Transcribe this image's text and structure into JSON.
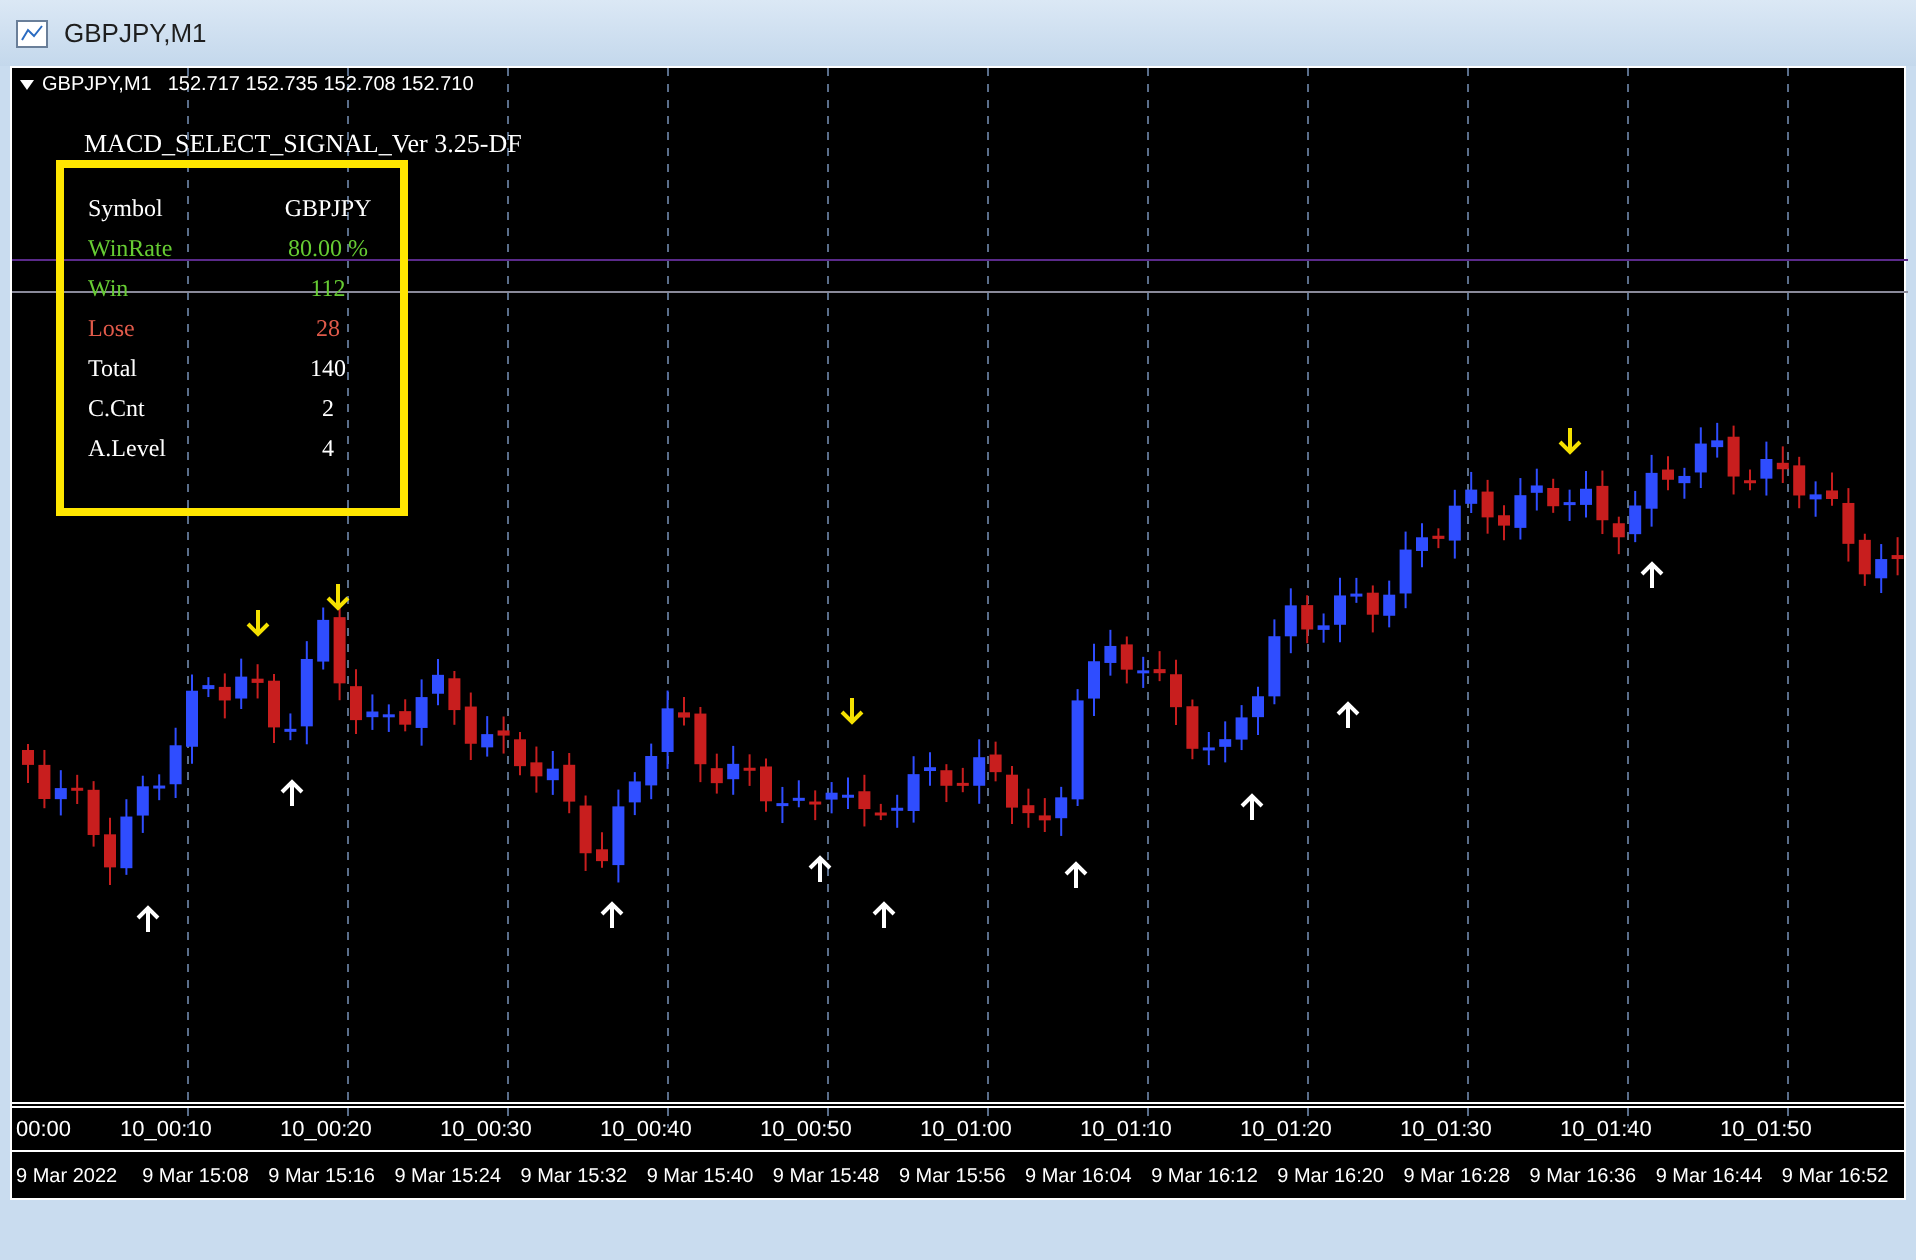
{
  "window": {
    "title": "GBPJPY,M1"
  },
  "chart_header": {
    "symbol": "GBPJPY,M1",
    "prices": "152.717 152.735 152.708 152.710"
  },
  "indicator": {
    "title": "MACD_SELECT_SIGNAL_Ver 3.25-DF"
  },
  "stats": [
    {
      "label": "Symbol",
      "value": "GBPJPY",
      "color": "#ffffff"
    },
    {
      "label": "WinRate",
      "value": "80.00 %",
      "color": "#66cc33"
    },
    {
      "label": "Win",
      "value": "112",
      "color": "#66cc33"
    },
    {
      "label": "Lose",
      "value": "28",
      "color": "#e05a4a"
    },
    {
      "label": "Total",
      "value": "140",
      "color": "#ffffff"
    },
    {
      "label": "C.Cnt",
      "value": "2",
      "color": "#ffffff"
    },
    {
      "label": "A.Level",
      "value": "4",
      "color": "#ffffff"
    }
  ],
  "time_axis": [
    "00:00",
    "10_00:10",
    "10_00:20",
    "10_00:30",
    "10_00:40",
    "10_00:50",
    "10_01:00",
    "10_01:10",
    "10_01:20",
    "10_01:30",
    "10_01:40",
    "10_01:50"
  ],
  "date_axis": [
    "9 Mar 2022",
    "9 Mar 15:08",
    "9 Mar 15:16",
    "9 Mar 15:24",
    "9 Mar 15:32",
    "9 Mar 15:40",
    "9 Mar 15:48",
    "9 Mar 15:56",
    "9 Mar 16:04",
    "9 Mar 16:12",
    "9 Mar 16:20",
    "9 Mar 16:28",
    "9 Mar 16:36",
    "9 Mar 16:44",
    "9 Mar 16:52"
  ]
}
